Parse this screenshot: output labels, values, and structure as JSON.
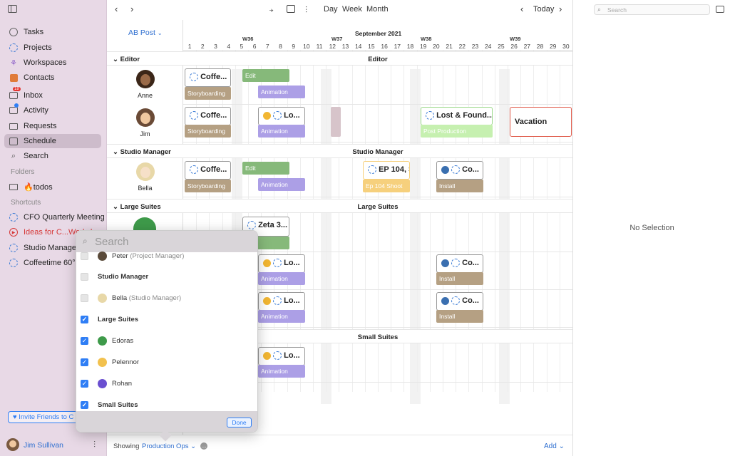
{
  "sidebar": {
    "items": [
      {
        "label": "Tasks"
      },
      {
        "label": "Projects"
      },
      {
        "label": "Workspaces"
      },
      {
        "label": "Contacts"
      },
      {
        "label": "Inbox",
        "badge": "18"
      },
      {
        "label": "Activity"
      },
      {
        "label": "Requests"
      },
      {
        "label": "Schedule"
      },
      {
        "label": "Search"
      }
    ],
    "folders_header": "Folders",
    "folder_item": "🔥todos",
    "shortcuts_header": "Shortcuts",
    "shortcuts": [
      {
        "label": "CFO Quarterly Meeting"
      },
      {
        "label": "Ideas for C...Workshop"
      },
      {
        "label": "Studio Management"
      },
      {
        "label": "Coffeetime 60° Spot"
      }
    ],
    "invite_label": "Invite Friends to C",
    "user_name": "Jim Sullivan"
  },
  "toolbar": {
    "views": [
      "Day",
      "Week",
      "Month"
    ],
    "today": "Today"
  },
  "schedule": {
    "project_selector": "AB Post",
    "month_label": "September 2021",
    "weeks": [
      "W36",
      "W37",
      "W38",
      "W39"
    ],
    "days": [
      "1",
      "2",
      "3",
      "4",
      "5",
      "6",
      "7",
      "8",
      "9",
      "10",
      "11",
      "12",
      "13",
      "14",
      "15",
      "16",
      "17",
      "18",
      "19",
      "20",
      "21",
      "22",
      "23",
      "24",
      "25",
      "26",
      "27",
      "28",
      "29",
      "30"
    ],
    "sections": {
      "editor": "Editor",
      "studio_manager": "Studio Manager",
      "large_suites": "Large Suites",
      "small_suites": "Small Suites"
    },
    "people": {
      "anne": "Anne",
      "jim": "Jim",
      "bella": "Bella"
    },
    "cards": {
      "coffee": "Coffe...",
      "lo": "Lo...",
      "lost": "Lost & Found...",
      "vacation": "Vacation",
      "ep104": "EP 104, S",
      "co": "Co...",
      "zeta": "Zeta 3..."
    },
    "tags": {
      "edit": "Edit",
      "animation": "Animation",
      "storyboarding": "Storyboarding",
      "post": "Post Production",
      "shoot": "Ep 104 Shoot",
      "install": "Install"
    }
  },
  "popover": {
    "search_placeholder": "Search",
    "rows": [
      {
        "label": "Peter",
        "role": "(Project Manager)",
        "checked": false
      },
      {
        "label": "Studio Manager",
        "checked": false,
        "header": true
      },
      {
        "label": "Bella",
        "role": "(Studio Manager)",
        "checked": false
      },
      {
        "label": "Large Suites",
        "checked": true,
        "header": true
      },
      {
        "label": "Edoras",
        "checked": true
      },
      {
        "label": "Pelennor",
        "checked": true
      },
      {
        "label": "Rohan",
        "checked": true
      },
      {
        "label": "Small Suites",
        "checked": true,
        "header": true
      }
    ],
    "done": "Done"
  },
  "footer": {
    "showing": "Showing",
    "filter": "Production Ops",
    "add": "Add"
  },
  "right": {
    "search_placeholder": "Search",
    "empty": "No Selection"
  },
  "colors": {
    "accent": "#2f7ef5",
    "sidebar_bg": "#e8d9e6",
    "edit": "#86b97a",
    "animation": "#ac9fe6",
    "storyboarding": "#b5a083"
  }
}
